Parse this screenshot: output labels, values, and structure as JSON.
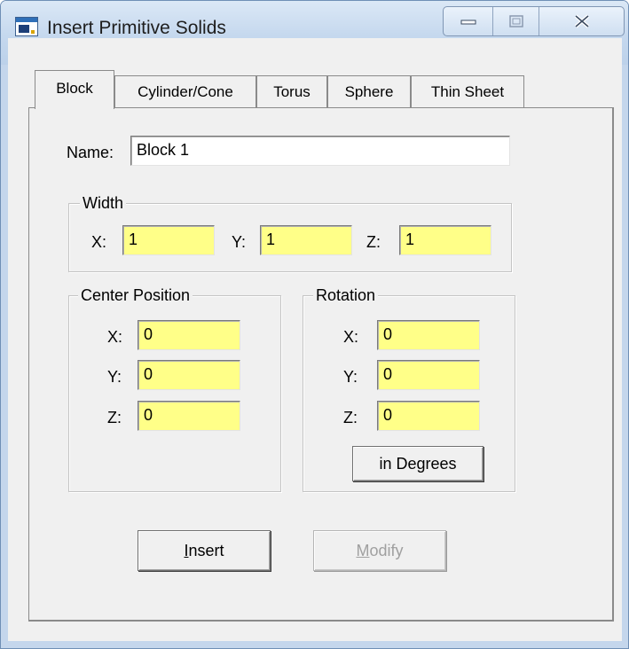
{
  "window": {
    "title": "Insert Primitive Solids"
  },
  "tabs": [
    {
      "label": "Block"
    },
    {
      "label": "Cylinder/Cone"
    },
    {
      "label": "Torus"
    },
    {
      "label": "Sphere"
    },
    {
      "label": "Thin Sheet"
    }
  ],
  "name_field": {
    "label": "Name:",
    "value": "Block 1"
  },
  "width": {
    "title": "Width",
    "x_label": "X:",
    "x_value": "1",
    "y_label": "Y:",
    "y_value": "1",
    "z_label": "Z:",
    "z_value": "1"
  },
  "center_position": {
    "title": "Center Position",
    "x_label": "X:",
    "x_value": "0",
    "y_label": "Y:",
    "y_value": "0",
    "z_label": "Z:",
    "z_value": "0"
  },
  "rotation": {
    "title": "Rotation",
    "x_label": "X:",
    "x_value": "0",
    "y_label": "Y:",
    "y_value": "0",
    "z_label": "Z:",
    "z_value": "0",
    "units_button": "in Degrees"
  },
  "buttons": {
    "insert_first": "I",
    "insert_rest": "nsert",
    "modify_first": "M",
    "modify_rest": "odify"
  },
  "colors": {
    "field_highlight": "#ffff88",
    "title_bar": "#c5d8ee"
  },
  "icons": [
    "app-window-icon",
    "minimize-icon",
    "maximize-icon",
    "close-icon"
  ]
}
